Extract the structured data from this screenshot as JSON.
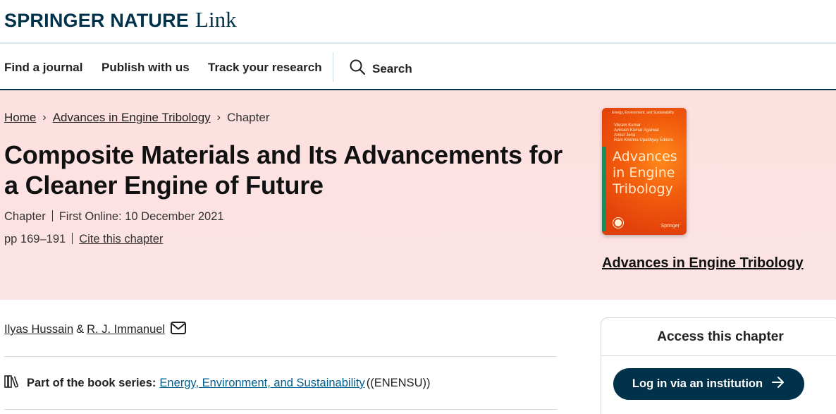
{
  "header": {
    "brand": "SPRINGER NATURE",
    "product": "Link"
  },
  "nav": {
    "items": [
      "Find a journal",
      "Publish with us",
      "Track your research"
    ],
    "search_label": "Search"
  },
  "breadcrumb": {
    "items": [
      "Home",
      "Advances in Engine Tribology"
    ],
    "current": "Chapter"
  },
  "chapter": {
    "title": "Composite Materials and Its Advancements for a Cleaner Engine of Future",
    "type": "Chapter",
    "first_online": "First Online: 10 December 2021",
    "pages": "pp 169–191",
    "cite_label": "Cite this chapter"
  },
  "book": {
    "cover_series": "Energy, Environment, and Sustainability",
    "cover_editors": [
      "Vikram Kumar",
      "Avinash Kumar Agarwal",
      "Ankur Jena",
      "Ram Krishna Upadhyay  Editors"
    ],
    "cover_title": [
      "Advances",
      "in Engine",
      "Tribology"
    ],
    "cover_publisher": "Springer",
    "title": "Advances in Engine Tribology"
  },
  "authors": {
    "list": [
      "Ilyas Hussain",
      "R. J. Immanuel"
    ],
    "separator": "&"
  },
  "series": {
    "label": "Part of the book series:",
    "name": "Energy, Environment, and Sustainability",
    "abbr": "((ENENSU))"
  },
  "access": {
    "heading": "Access this chapter",
    "login_label": "Log in via an institution"
  },
  "colors": {
    "brand": "#01324b",
    "hero_bg": "#fde0e0",
    "link": "#025e8d",
    "cover": "#f25c0d"
  }
}
